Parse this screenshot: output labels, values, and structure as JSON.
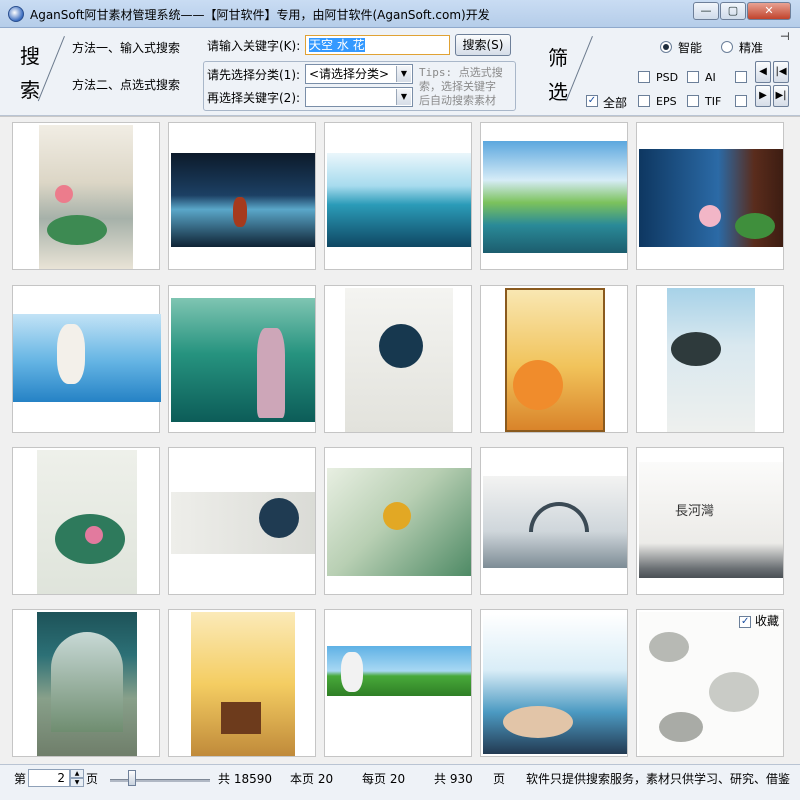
{
  "window": {
    "title": "AganSoft阿甘素材管理系统——【阿甘软件】专用，由阿甘软件(AganSoft.com)开发",
    "min_label": "—",
    "max_label": "▢",
    "close_label": "✕"
  },
  "search": {
    "big_char1": "搜",
    "big_char2": "索",
    "method1": "方法一、输入式搜索",
    "method2": "方法二、点选式搜索",
    "keyword_label": "请输入关键字(K):",
    "keyword_value": "天空 水 花",
    "search_button": "搜索(S)",
    "category_label": "请先选择分类(1):",
    "category_value": "<请选择分类>",
    "subkey_label": "再选择关键字(2):",
    "subkey_value": "",
    "tips": [
      "Tips: 点选式搜",
      "索，选择关键字",
      "后自动搜索素材"
    ]
  },
  "filter": {
    "big_char1": "筛",
    "big_char2": "选",
    "mode_smart": "智能",
    "mode_exact": "精准",
    "all_label": "全部",
    "formats": [
      "PSD",
      "AI",
      "EPS",
      "TIF"
    ]
  },
  "grid": {
    "fav_label": "收藏"
  },
  "status": {
    "page_prefix": "第",
    "page_value": "2",
    "page_suffix": "页",
    "total": "共 18590",
    "this_page": "本页 20",
    "per_page": "每页 20",
    "total_pages": "共 930",
    "pages_unit": "页",
    "notice": "软件只提供搜索服务，素材只供学习、研究、借鉴"
  },
  "colors": {
    "accent": "#3399ff",
    "titlebar": "#c9dcf3"
  }
}
